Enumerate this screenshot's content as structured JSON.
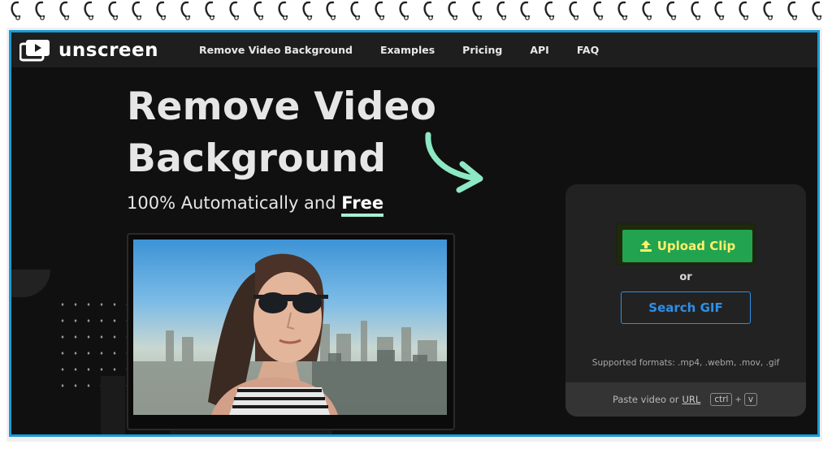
{
  "nav": {
    "brand": "unscreen",
    "links": [
      "Remove Video Background",
      "Examples",
      "Pricing",
      "API",
      "FAQ"
    ]
  },
  "hero": {
    "title_line1": "Remove Video",
    "title_line2": "Background",
    "subtitle": "100% Automatically and",
    "subtitle_emphasis": "Free"
  },
  "panel": {
    "upload_label": "Upload Clip",
    "or_label": "or",
    "search_label": "Search GIF",
    "formats": "Supported formats: .mp4, .webm, .mov, .gif",
    "paste_prefix": "Paste video or",
    "paste_link": "URL",
    "key1": "ctrl",
    "plus": "+",
    "key2": "v"
  },
  "colors": {
    "accent_frame": "#1a9ad6",
    "upload_bg": "#22a350",
    "upload_text": "#ffef6b",
    "search_text": "#2e8fe6",
    "arrow": "#8de8c4"
  },
  "icons": [
    "ring-icon",
    "play-logo-icon",
    "curved-arrow-icon",
    "upload-icon"
  ]
}
